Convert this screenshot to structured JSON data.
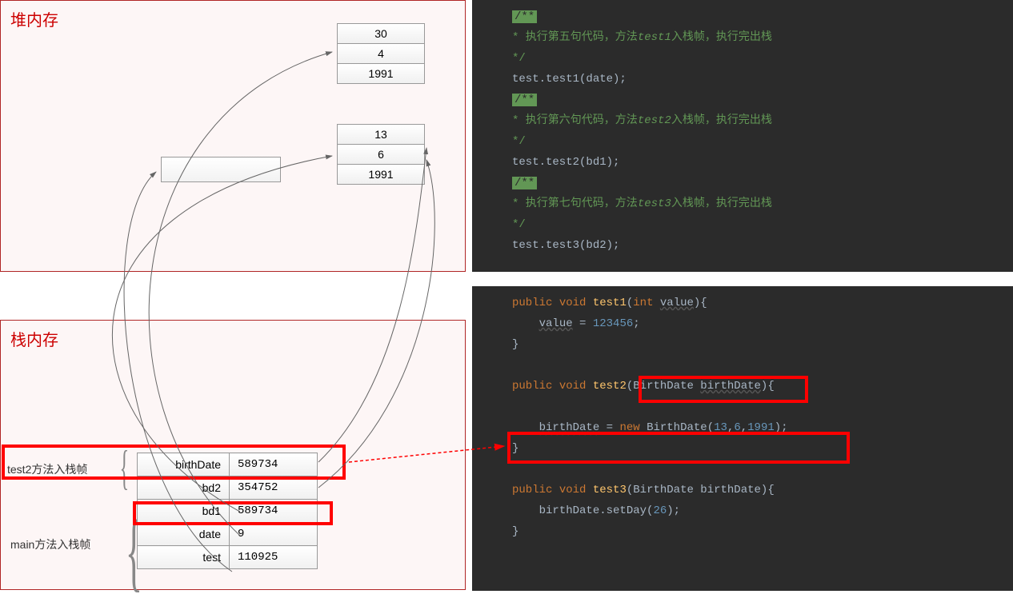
{
  "heap": {
    "title": "堆内存",
    "obj1": {
      "cells": [
        "30",
        "4",
        "1991"
      ]
    },
    "obj2": {
      "cells": [
        "13",
        "6",
        "1991"
      ]
    }
  },
  "stack": {
    "title": "栈内存",
    "frame_test2_label": "test2方法入栈帧",
    "frame_main_label": "main方法入栈帧",
    "rows": [
      {
        "name": "birthDate",
        "value": "589734"
      },
      {
        "name": "bd2",
        "value": "354752"
      },
      {
        "name": "bd1",
        "value": "589734"
      },
      {
        "name": "date",
        "value": "9"
      },
      {
        "name": "test",
        "value": "110925"
      }
    ]
  },
  "code1": {
    "c1a": "/**",
    "c1b": " * 执行第五句代码，方法",
    "c1c": "test1",
    "c1d": "入栈帧，执行完出栈",
    "c1e": " */",
    "l1": "test.test1(date);",
    "c2a": "/**",
    "c2b": " * 执行第六句代码，方法",
    "c2c": "test2",
    "c2d": "入栈帧，执行完出栈",
    "c2e": " */",
    "l2": "test.test2(bd1);",
    "c3a": "/**",
    "c3b": " * 执行第七句代码，方法",
    "c3c": "test3",
    "c3d": "入栈帧，执行完出栈",
    "c3e": " */",
    "l3": "test.test3(bd2);"
  },
  "code2": {
    "m1_sig_pub": "public",
    "m1_sig_void": "void",
    "m1_name": "test1",
    "m1_ptype": "int",
    "m1_pname": "value",
    "m1_body_var": "value",
    "m1_body_eq": " = ",
    "m1_body_val": "123456",
    "m2_name": "test2",
    "m2_ptype": "BirthDate",
    "m2_pname": "birthDate",
    "m2_body_var": "birthDate",
    "m2_body_new": "new",
    "m2_body_type": "BirthDate",
    "m2_body_args_a": "13",
    "m2_body_args_b": "6",
    "m2_body_args_c": "1991",
    "m3_name": "test3",
    "m3_ptype": "BirthDate",
    "m3_pname": "birthDate",
    "m3_body": "birthDate.setDay(",
    "m3_body_arg": "26",
    "m3_body_end": ");"
  }
}
